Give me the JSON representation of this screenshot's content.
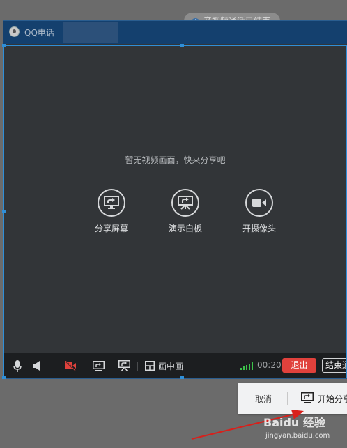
{
  "background_notice": {
    "text": "音视频通话已结束"
  },
  "window": {
    "title": "QQ电话",
    "empty_message": "暂无视频画面，快来分享吧",
    "share_options": [
      {
        "label": "分享屏幕",
        "icon": "share-screen-icon"
      },
      {
        "label": "演示白板",
        "icon": "whiteboard-icon"
      },
      {
        "label": "开摄像头",
        "icon": "camera-icon"
      }
    ]
  },
  "toolbar": {
    "pip_label": "画中画",
    "timer": "00:20",
    "exit_label": "退出",
    "end_label": "结束通话",
    "signal_color": "#3cc24a",
    "exit_color": "#e0413c"
  },
  "confirm": {
    "cancel_label": "取消",
    "start_label": "开始分享"
  },
  "watermark": {
    "text": "Baidu 经验",
    "url": "jingyan.baidu.com"
  }
}
